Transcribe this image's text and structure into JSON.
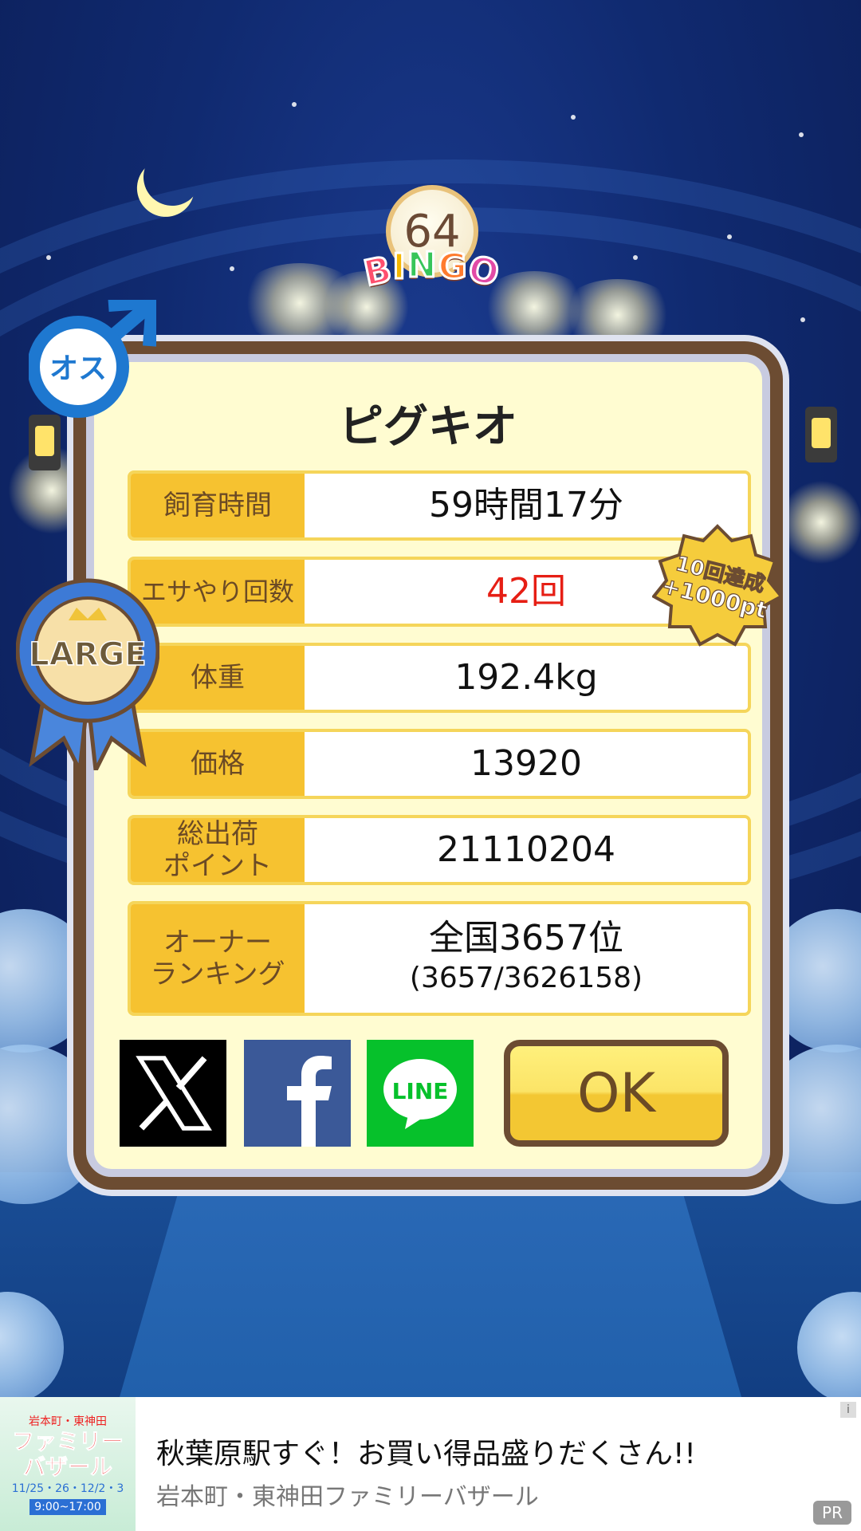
{
  "bingo": {
    "number": "64",
    "word": "BINGO",
    "letter_colors": [
      "#ff4f6e",
      "#f5b700",
      "#37c55a",
      "#ff7b2e",
      "#e24aa6"
    ]
  },
  "badges": {
    "gender": "オス",
    "size": "LARGE",
    "achievement_line1": "10回達成",
    "achievement_line2": "+1000pt"
  },
  "pig": {
    "name": "ピグキオ",
    "rows": [
      {
        "label": "飼育時間",
        "value": "59時間17分"
      },
      {
        "label": "エサやり回数",
        "value": "42回"
      },
      {
        "label": "体重",
        "value": "192.4kg"
      },
      {
        "label": "価格",
        "value": "13920"
      },
      {
        "label_line1": "総出荷",
        "label_line2": "ポイント",
        "value": "21110204"
      },
      {
        "label_line1": "オーナー",
        "label_line2": "ランキング",
        "value_line1": "全国3657位",
        "value_line2": "(3657/3626158)"
      }
    ]
  },
  "share": {
    "x_icon": "x-logo-icon",
    "facebook_icon": "facebook-icon",
    "line_text": "LINE"
  },
  "ok_label": "OK",
  "ad": {
    "image_top": "岩本町・東神田",
    "image_main_line1": "ファミリー",
    "image_main_line2": "バザール",
    "image_dates": "11/25・26・12/2・3",
    "image_time": "9:00~17:00",
    "title": "秋葉原駅すぐ！お買い得品盛りだくさん!!",
    "subtitle": "岩本町・東神田ファミリーバザール",
    "info_icon": "i",
    "pr_label": "PR"
  },
  "colors": {
    "dialog_border": "#6c4c32",
    "label_bg": "#f6c230",
    "highlight_value": "#e61e14",
    "ok_button": "#f3c733"
  }
}
